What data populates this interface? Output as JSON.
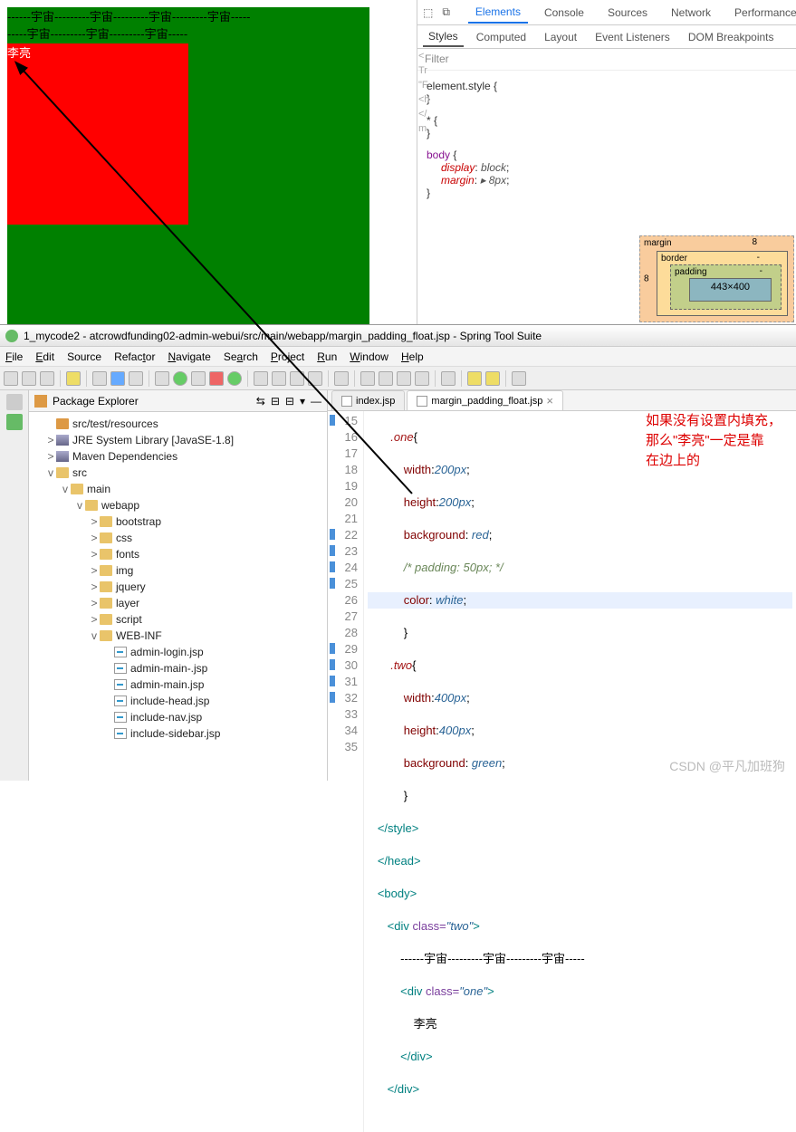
{
  "browser": {
    "dash_row1": "------宇宙---------宇宙---------宇宙---------宇宙-----",
    "dash_row2": "-----宇宙---------宇宙---------宇宙-----",
    "red_text": "李亮"
  },
  "devtools": {
    "tabs": [
      "Elements",
      "Console",
      "Sources",
      "Network",
      "Performance"
    ],
    "subtabs": [
      "Styles",
      "Computed",
      "Layout",
      "Event Listeners",
      "DOM Breakpoints"
    ],
    "filter": "Filter",
    "gutter": [
      "<",
      "",
      "Tr",
      "\"F",
      "<h",
      "",
      "",
      "",
      "</",
      "",
      "m"
    ],
    "rule1": "element.style {",
    "rule1b": "}",
    "rule2": "* {",
    "rule2b": "}",
    "rule3_sel": "body",
    "rule3_a_prop": "display",
    "rule3_a_val": "block",
    "rule3_b_prop": "margin",
    "rule3_b_val": "▸ 8px",
    "bm": {
      "margin": "margin",
      "margin_v": "8",
      "border": "border",
      "border_v": "-",
      "padding": "padding",
      "padding_v": "-",
      "content": "443×400",
      "left8": "8"
    }
  },
  "eclipse": {
    "title": "1_mycode2 - atcrowdfunding02-admin-webui/src/main/webapp/margin_padding_float.jsp - Spring Tool Suite",
    "menu": [
      "File",
      "Edit",
      "Source",
      "Refactor",
      "Navigate",
      "Search",
      "Project",
      "Run",
      "Window",
      "Help"
    ],
    "explorer": {
      "title": "Package Explorer",
      "tree": [
        {
          "indent": 1,
          "tw": "",
          "ic": "pkg",
          "label": "src/test/resources"
        },
        {
          "indent": 1,
          "tw": ">",
          "ic": "lib",
          "label": "JRE System Library [JavaSE-1.8]"
        },
        {
          "indent": 1,
          "tw": ">",
          "ic": "lib",
          "label": "Maven Dependencies"
        },
        {
          "indent": 1,
          "tw": "v",
          "ic": "fldo",
          "label": "src"
        },
        {
          "indent": 2,
          "tw": "v",
          "ic": "fldo",
          "label": "main"
        },
        {
          "indent": 3,
          "tw": "v",
          "ic": "fldo",
          "label": "webapp"
        },
        {
          "indent": 4,
          "tw": ">",
          "ic": "fld",
          "label": "bootstrap"
        },
        {
          "indent": 4,
          "tw": ">",
          "ic": "fld",
          "label": "css"
        },
        {
          "indent": 4,
          "tw": ">",
          "ic": "fld",
          "label": "fonts"
        },
        {
          "indent": 4,
          "tw": ">",
          "ic": "fld",
          "label": "img"
        },
        {
          "indent": 4,
          "tw": ">",
          "ic": "fld",
          "label": "jquery"
        },
        {
          "indent": 4,
          "tw": ">",
          "ic": "fld",
          "label": "layer"
        },
        {
          "indent": 4,
          "tw": ">",
          "ic": "fld",
          "label": "script"
        },
        {
          "indent": 4,
          "tw": "v",
          "ic": "fldo",
          "label": "WEB-INF"
        },
        {
          "indent": 5,
          "tw": "",
          "ic": "jsp",
          "label": "admin-login.jsp"
        },
        {
          "indent": 5,
          "tw": "",
          "ic": "jsp",
          "label": "admin-main-.jsp"
        },
        {
          "indent": 5,
          "tw": "",
          "ic": "jsp",
          "label": "admin-main.jsp"
        },
        {
          "indent": 5,
          "tw": "",
          "ic": "jsp",
          "label": "include-head.jsp"
        },
        {
          "indent": 5,
          "tw": "",
          "ic": "jsp",
          "label": "include-nav.jsp"
        },
        {
          "indent": 5,
          "tw": "",
          "ic": "jsp",
          "label": "include-sidebar.jsp"
        }
      ]
    },
    "tabs": [
      {
        "label": "index.jsp",
        "active": false,
        "close": "×"
      },
      {
        "label": "margin_padding_float.jsp",
        "active": true,
        "close": "×"
      }
    ],
    "lines": [
      15,
      16,
      17,
      18,
      19,
      20,
      21,
      22,
      23,
      24,
      25,
      26,
      27,
      28,
      29,
      30,
      31,
      32,
      33,
      34,
      35
    ],
    "code": {
      "l15": ".one",
      "l15b": "{",
      "l16p": "width",
      "l16v": "200px",
      "l16s": ";",
      "l17p": "height",
      "l17v": "200px",
      "l17s": ";",
      "l18p": "background",
      "l18v": "red",
      "l18s": ";",
      "l19": "/* padding: 50px; */",
      "l20p": "color",
      "l20v": "white",
      "l20s": ";",
      "l21": "}",
      "l22": ".two",
      "l22b": "{",
      "l23p": "width",
      "l23v": "400px",
      "l23s": ";",
      "l24p": "height",
      "l24v": "400px",
      "l24s": ";",
      "l25p": "background",
      "l25v": "green",
      "l25s": ";",
      "l26": "}",
      "l27": "</style>",
      "l28": "</head>",
      "l29": "<body>",
      "l30a": "<div",
      "l30b": "class=",
      "l30c": "\"two\"",
      "l30d": ">",
      "l31": "------宇宙---------宇宙---------宇宙-----",
      "l32a": "<div",
      "l32b": "class=",
      "l32c": "\"one\"",
      "l32d": ">",
      "l33": "李亮",
      "l34": "</div>",
      "l35": "</div>"
    },
    "annotation": [
      "如果没有设置内填充，",
      "那么\"李亮\"一定是靠",
      "在边上的"
    ]
  },
  "watermark": "CSDN @平凡加班狗"
}
